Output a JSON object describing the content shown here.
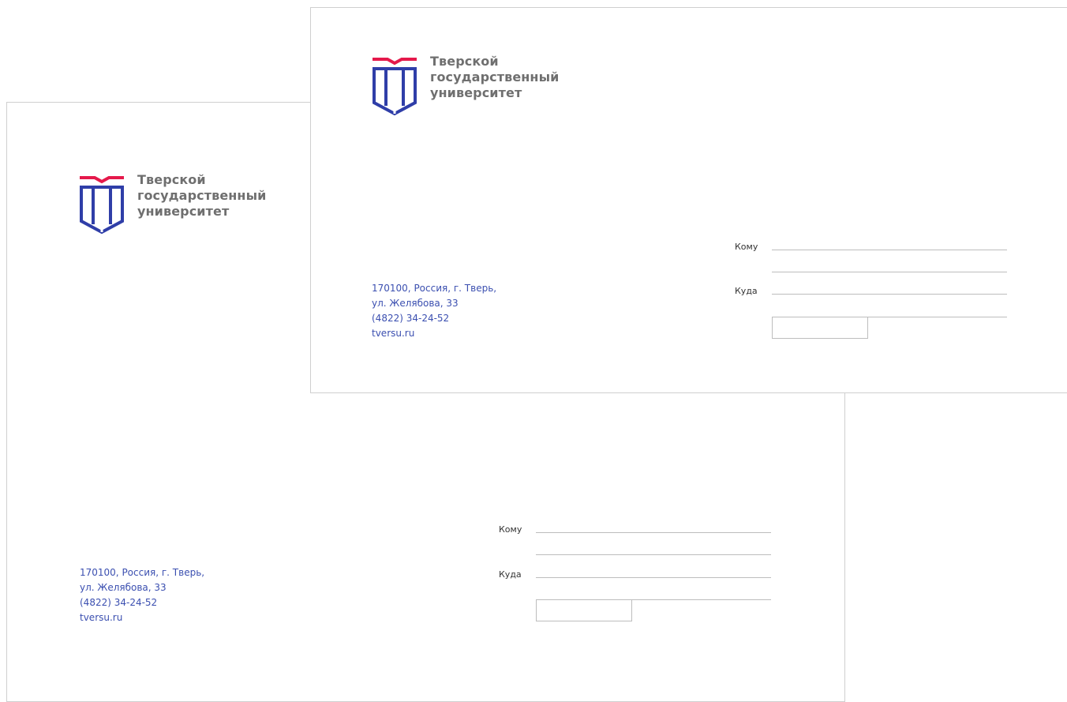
{
  "logo": {
    "line1": "Тверской",
    "line2": "государственный",
    "line3": "университет",
    "colors": {
      "accent": "#e5194b",
      "primary": "#2f3ea8",
      "text": "#6f6f6f"
    }
  },
  "sender": {
    "line1": "170100, Россия, г. Тверь,",
    "line2": "ул. Желябова, 33",
    "line3": "(4822) 34-24-52",
    "line4": "tversu.ru"
  },
  "recipient": {
    "to_label": "Кому",
    "where_label": "Куда"
  }
}
